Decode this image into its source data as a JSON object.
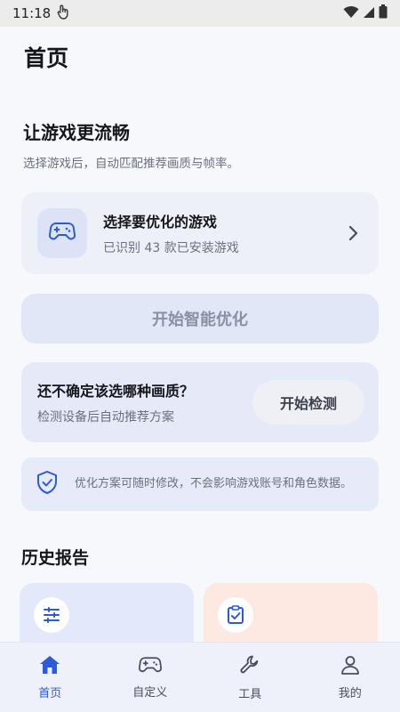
{
  "status_bar": {
    "time": "11:18"
  },
  "page": {
    "title": "首页"
  },
  "optimize": {
    "title": "让游戏更流畅",
    "subtitle": "选择游戏后，自动匹配推荐画质与帧率。",
    "game_select": {
      "title": "选择要优化的游戏",
      "desc": "已识别 43 款已安装游戏"
    },
    "start_button": "开始智能优化"
  },
  "detect": {
    "title": "还不确定该选哪种画质？",
    "desc": "检测设备后自动推荐方案",
    "button": "开始检测"
  },
  "notice": {
    "text": "优化方案可随时修改，不会影响游戏账号和角色数据。"
  },
  "history": {
    "title": "历史报告"
  },
  "bottom_nav": {
    "items": [
      {
        "label": "首页",
        "icon": "home-icon",
        "active": true
      },
      {
        "label": "自定义",
        "icon": "gamepad-icon",
        "active": false
      },
      {
        "label": "工具",
        "icon": "wrench-icon",
        "active": false
      },
      {
        "label": "我的",
        "icon": "person-icon",
        "active": false
      }
    ]
  },
  "colors": {
    "accent": "#2c5bd6",
    "background": "#f7f8fc",
    "card": "#eef0f7"
  }
}
